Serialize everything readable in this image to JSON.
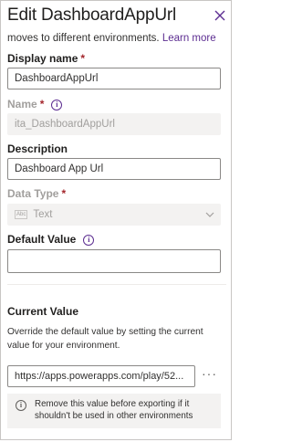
{
  "panel": {
    "title": "Edit DashboardAppUrl",
    "intro_text": "moves to different environments.",
    "learn_more": "Learn more"
  },
  "display_name": {
    "label": "Display name",
    "required": "*",
    "value": "DashboardAppUrl"
  },
  "name": {
    "label": "Name",
    "required": "*",
    "value": "ita_DashboardAppUrl"
  },
  "description": {
    "label": "Description",
    "value": "Dashboard App Url"
  },
  "data_type": {
    "label": "Data Type",
    "required": "*",
    "icon_text": "Abc",
    "value": "Text"
  },
  "default_value": {
    "label": "Default Value",
    "value": ""
  },
  "current_value": {
    "label": "Current Value",
    "help": "Override the default value by setting the current value for your environment.",
    "value": "https://apps.powerapps.com/play/52...",
    "more": "···",
    "note": "Remove this value before exporting if it shouldn't be used in other environments"
  },
  "icons": {
    "close": "close-icon",
    "info": "info-icon",
    "chevron": "chevron-down-icon"
  },
  "colors": {
    "accent": "#5c2d91",
    "required": "#a4262c",
    "border": "#8a8886",
    "disabled_bg": "#f3f2f1"
  }
}
